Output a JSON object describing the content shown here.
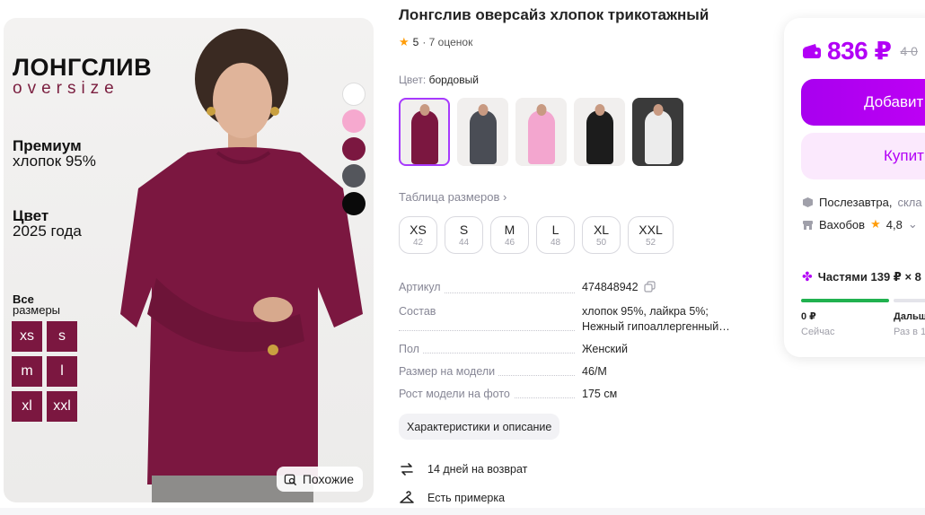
{
  "product": {
    "title": "Лонгслив оверсайз хлопок трикотажный",
    "rating": "5",
    "reviews": "· 7 оценок",
    "color_label": "Цвет:",
    "color_value": "бордовый",
    "size_table_link": "Таблица размеров ›",
    "sizes": [
      {
        "name": "XS",
        "ru": "42"
      },
      {
        "name": "S",
        "ru": "44"
      },
      {
        "name": "M",
        "ru": "46"
      },
      {
        "name": "L",
        "ru": "48"
      },
      {
        "name": "XL",
        "ru": "50"
      },
      {
        "name": "XXL",
        "ru": "52"
      }
    ],
    "variant_colors": [
      "#7b1740",
      "#4a4d55",
      "#f3a6cf",
      "#1c1c1c",
      "#ececec"
    ],
    "specs": [
      {
        "key": "Артикул",
        "value": "474848942"
      },
      {
        "key": "Состав",
        "value": "хлопок 95%, лайкра 5%; Нежный гипоаллергенный…"
      },
      {
        "key": "Пол",
        "value": "Женский"
      },
      {
        "key": "Размер на модели",
        "value": "46/M"
      },
      {
        "key": "Рост модели на фото",
        "value": "175 см"
      }
    ],
    "description_button": "Характеристики и описание",
    "return_policy": "14 дней на возврат",
    "fitting": "Есть примерка"
  },
  "photo": {
    "headline": "ЛОНГСЛИВ",
    "subhead": "oversize",
    "premium_1": "Премиум",
    "premium_2": "хлопок 95%",
    "color_1": "Цвет",
    "color_2": "2025 года",
    "sizes_1": "Все",
    "sizes_2": "размеры",
    "size_tiles": [
      "xs",
      "s",
      "m",
      "l",
      "xl",
      "xxl"
    ],
    "swatches": [
      "#ffffff",
      "#f6a9cf",
      "#7b1740",
      "#54565c",
      "#0a0a0a"
    ],
    "similar_button": "Похожие"
  },
  "buy_card": {
    "price": "836 ₽",
    "old_price": "4 0",
    "add_button": "Добавит",
    "buy_button": "Купит",
    "delivery": "Послезавтра,",
    "warehouse": "скла",
    "seller": "Вахобов",
    "seller_rating": "4,8",
    "installments": "Частями 139 ₽ × 8",
    "pay_now_amount": "0 ₽",
    "pay_now_label": "Сейчас",
    "pay_later_amount": "Дальш",
    "pay_later_label": "Раз в 1"
  },
  "colors": {
    "accent": "#b200f6",
    "burgundy": "#7b1740",
    "star": "#ff9d0a",
    "progress": "#21b14f"
  }
}
